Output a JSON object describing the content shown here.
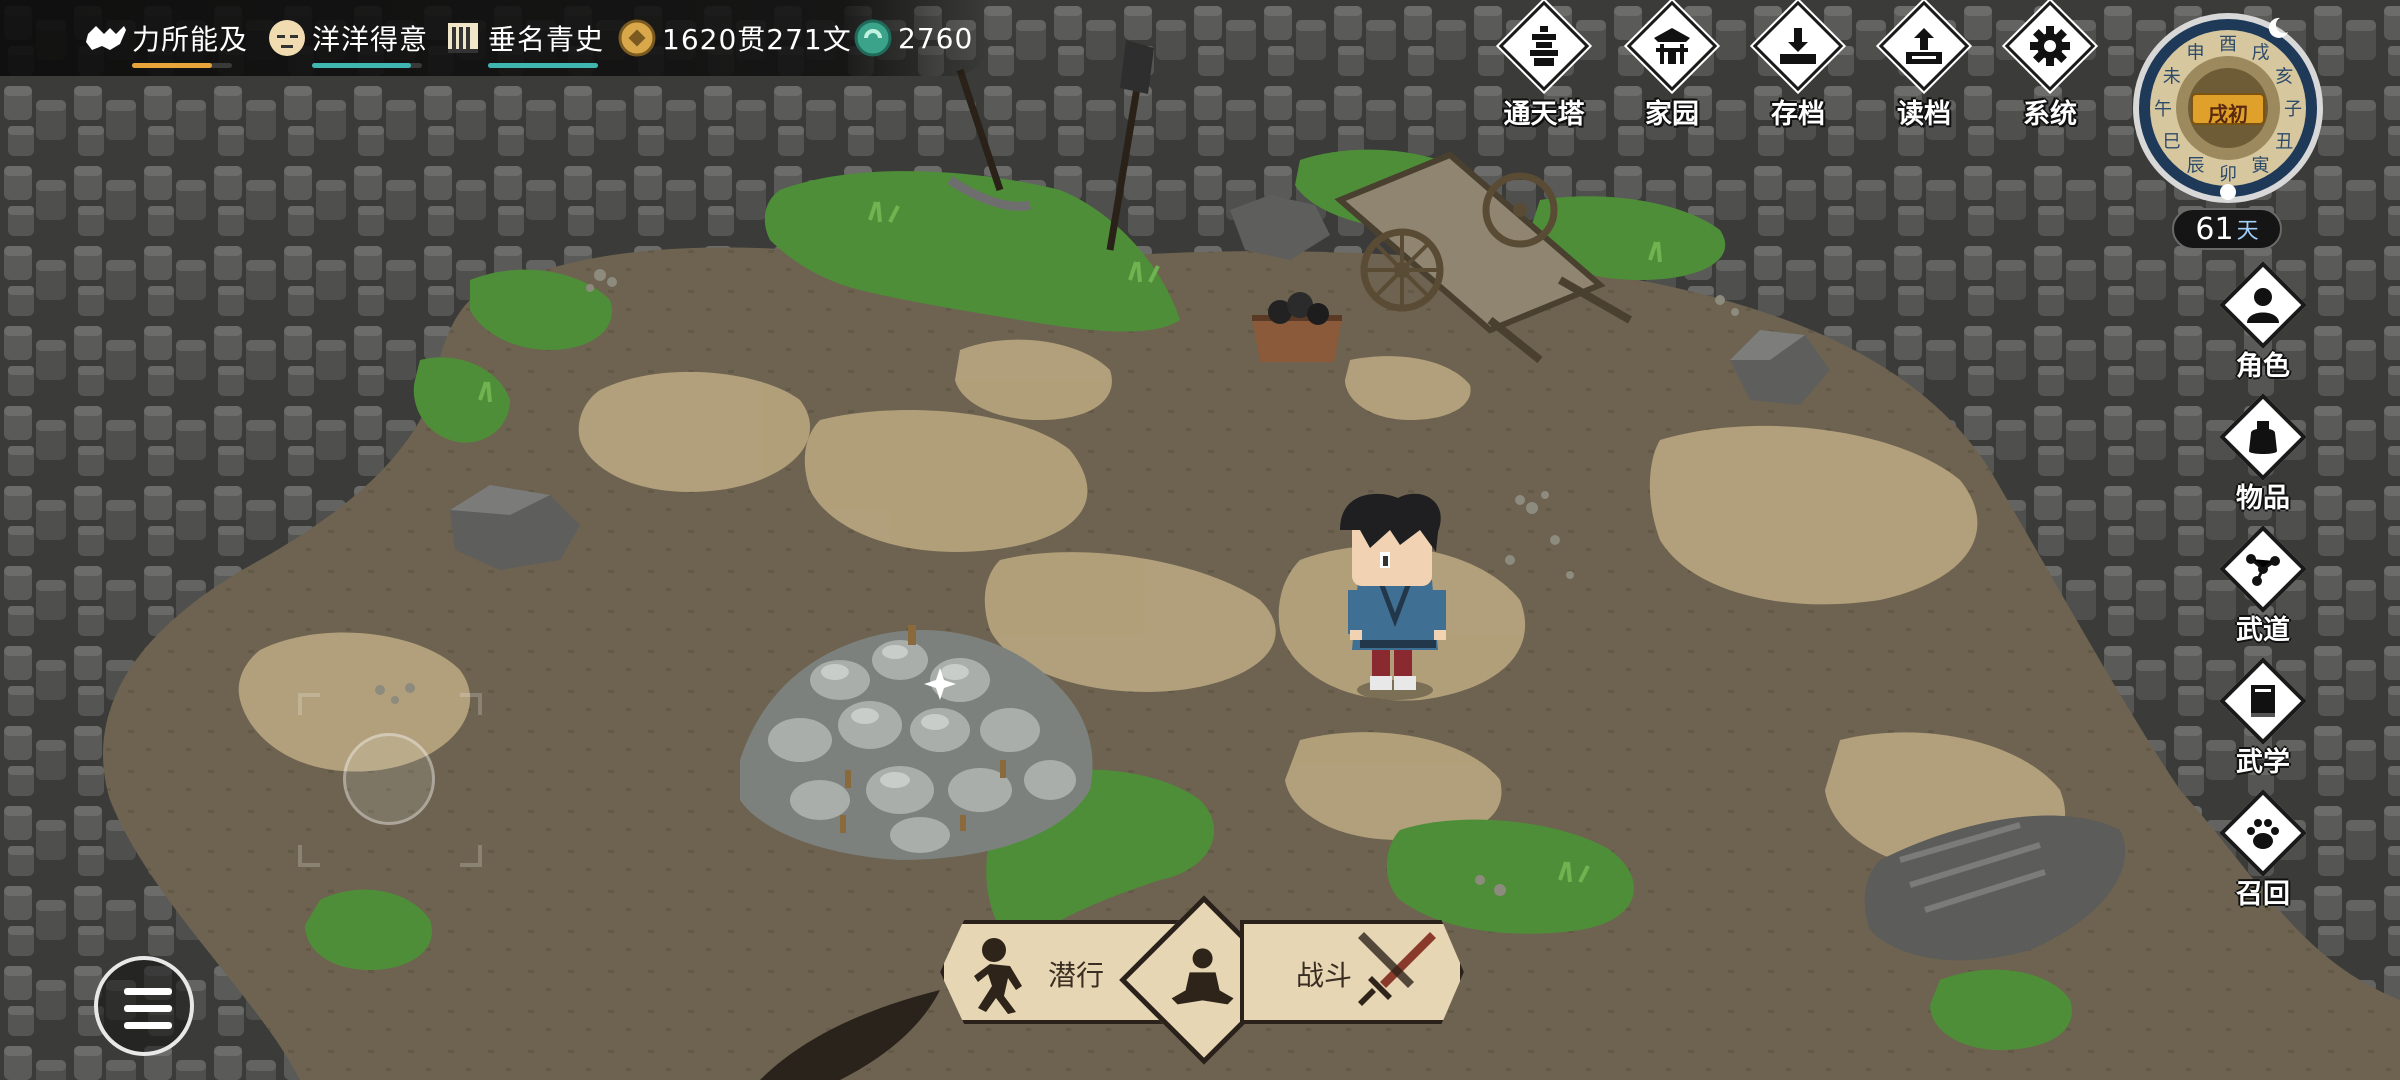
{
  "status_bar": {
    "stamina": {
      "label": "力所能及",
      "icon": "strength-icon",
      "bar_color": "#e8a33a",
      "fill_fraction": 0.8
    },
    "mood": {
      "label": "洋洋得意",
      "icon": "face-icon",
      "bar_color": "#3fb6b0",
      "fill_fraction": 0.9
    },
    "fame": {
      "label": "垂名青史",
      "icon": "scroll-icon",
      "bar_color": "#3fb6b0",
      "fill_fraction": 1.0
    },
    "copper": {
      "value": "1620贯271文",
      "icon": "coin-icon"
    },
    "jade": {
      "value": "2760",
      "icon": "jade-icon"
    }
  },
  "top_menu": [
    {
      "label": "通天塔",
      "icon": "tower-icon"
    },
    {
      "label": "家园",
      "icon": "home-icon"
    },
    {
      "label": "存档",
      "icon": "save-icon"
    },
    {
      "label": "读档",
      "icon": "load-icon"
    },
    {
      "label": "系统",
      "icon": "gear-icon"
    }
  ],
  "clock": {
    "time_label": "戌初",
    "zodiac_hours": [
      "戌",
      "亥",
      "子",
      "丑",
      "寅",
      "卯",
      "辰",
      "巳",
      "午",
      "未",
      "申",
      "酉"
    ],
    "day_count": "61",
    "day_unit": "天"
  },
  "side_menu": [
    {
      "label": "角色",
      "icon": "person-icon"
    },
    {
      "label": "物品",
      "icon": "bag-icon"
    },
    {
      "label": "武道",
      "icon": "constellation-icon"
    },
    {
      "label": "武学",
      "icon": "book-icon"
    },
    {
      "label": "召回",
      "icon": "paw-icon"
    }
  ],
  "actions": {
    "sneak": "潜行",
    "meditate_icon": "meditate-icon",
    "fight": "战斗"
  },
  "colors": {
    "ground": "#6f6452",
    "sand": "#b9a984",
    "rock": "#4a4a48",
    "grass": "#4e8f3a",
    "panel": "#e6d6b4"
  }
}
